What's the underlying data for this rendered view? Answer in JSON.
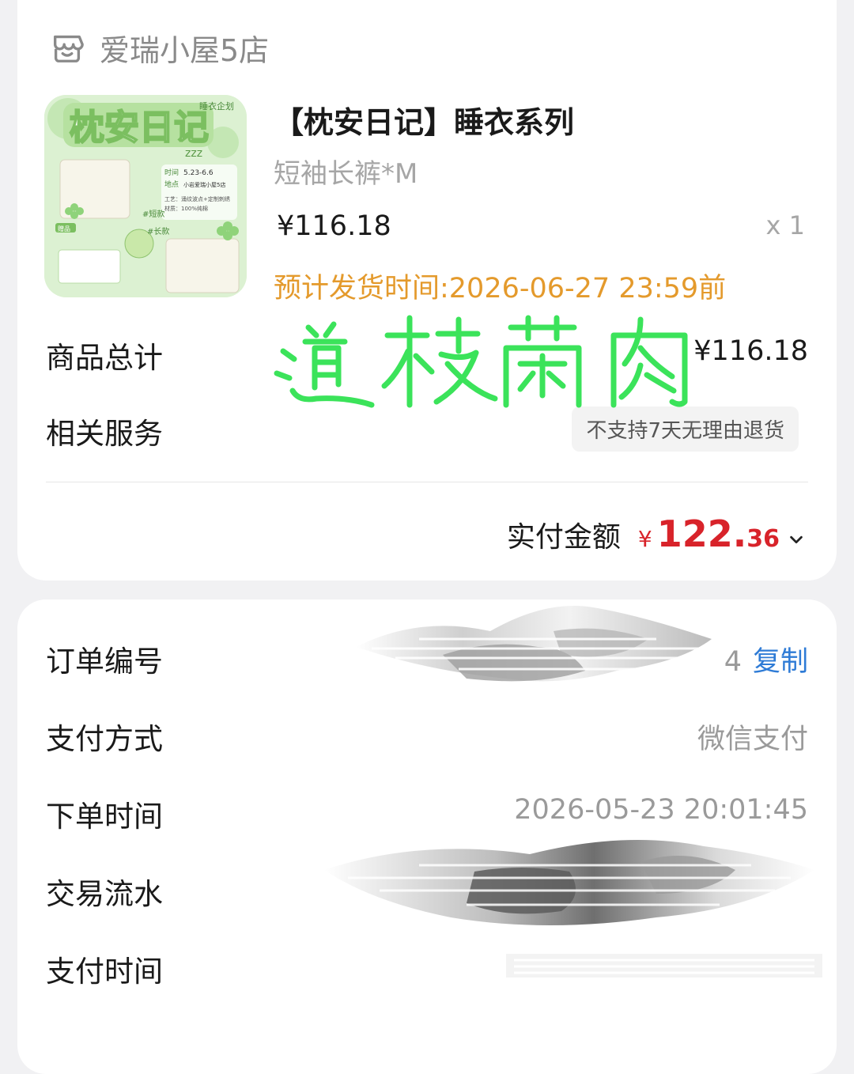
{
  "shop": {
    "name": "爱瑞小屋5店",
    "icon": "shop-icon"
  },
  "product": {
    "title": "【枕安日记】睡衣系列",
    "spec": "短袖长裤*M",
    "price": "¥116.18",
    "quantity": "x 1",
    "shipping": "预计发货时间:2026-06-27 23:59前",
    "thumb": {
      "title": "枕安日记",
      "tag": "睡衣企划",
      "zzz": "zzz",
      "info_time_label": "时间",
      "info_time": "5.23-6.6",
      "info_place_label": "地点",
      "info_place": "小岩爱瑞小屋5店",
      "craft": "工艺：涌纹波点+定制刺绣",
      "material": "材质：100%纯棉",
      "short_tag": "#短款",
      "long_tag": "#长款",
      "gift_label": "赠品"
    }
  },
  "summary": {
    "goods_total_label": "商品总计",
    "goods_total_value": "¥116.18",
    "service_label": "相关服务",
    "service_badge": "不支持7天无理由退货",
    "paid_label": "实付金额",
    "paid_symbol": "¥",
    "paid_int": "122.",
    "paid_dec": "36"
  },
  "handwriting_text": "道枝菌肉",
  "order": {
    "number_label": "订单编号",
    "number_tail": "4",
    "copy_label": "复制",
    "payment_label": "支付方式",
    "payment_value": "微信支付",
    "order_time_label": "下单时间",
    "order_time_value": "2026-05-23 20:01:45",
    "transaction_label": "交易流水",
    "pay_time_label": "支付时间"
  },
  "colors": {
    "accent_price": "#d8232a",
    "shipping": "#e49a2c",
    "link": "#2e7bd6",
    "handwriting": "#3be35a"
  }
}
